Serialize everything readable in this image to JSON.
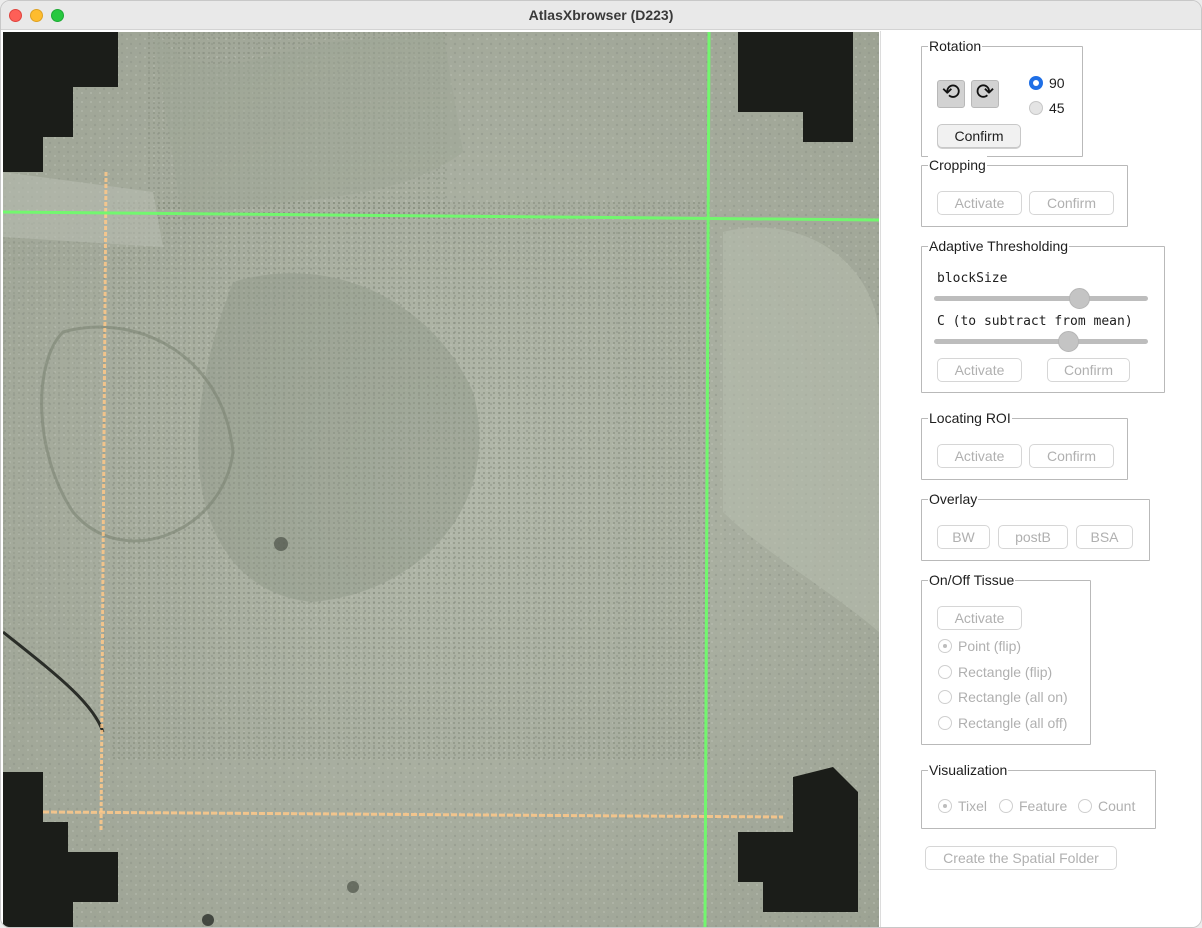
{
  "window": {
    "title": "AtlasXbrowser (D223)"
  },
  "rotation": {
    "title": "Rotation",
    "ccw_icon": "rotate-ccw-icon",
    "cw_icon": "rotate-cw-icon",
    "ccw_glyph": "⟲",
    "cw_glyph": "⟳",
    "options": [
      "90",
      "45"
    ],
    "selected": "90",
    "confirm_label": "Confirm"
  },
  "cropping": {
    "title": "Cropping",
    "activate_label": "Activate",
    "confirm_label": "Confirm"
  },
  "thresholding": {
    "title": "Adaptive Thresholding",
    "block_label": "blockSize",
    "block_value": 0.68,
    "c_label": "C (to subtract from mean)",
    "c_value": 0.63,
    "activate_label": "Activate",
    "confirm_label": "Confirm"
  },
  "roi": {
    "title": "Locating ROI",
    "activate_label": "Activate",
    "confirm_label": "Confirm"
  },
  "overlay": {
    "title": "Overlay",
    "buttons": [
      "BW",
      "postB",
      "BSA"
    ]
  },
  "tissue": {
    "title": "On/Off Tissue",
    "activate_label": "Activate",
    "options": [
      "Point (flip)",
      "Rectangle (flip)",
      "Rectangle (all on)",
      "Rectangle (all off)"
    ],
    "selected": "Point (flip)"
  },
  "visualization": {
    "title": "Visualization",
    "options": [
      "Tixel",
      "Feature",
      "Count"
    ],
    "selected": "Tixel"
  },
  "spatial_folder_label": "Create the Spatial Folder",
  "colors": {
    "accent": "#1f6fe6",
    "disabled_text": "#b0b0b0",
    "green_line": "#6dff6a",
    "orange_line": "#ffc98a"
  }
}
